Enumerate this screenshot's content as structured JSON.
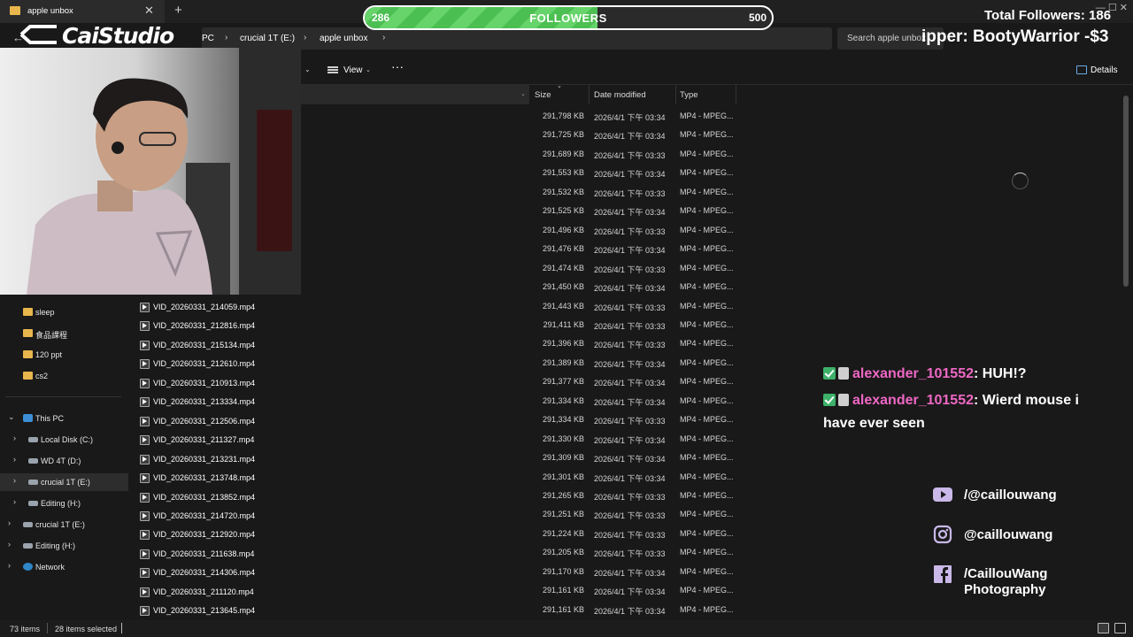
{
  "window": {
    "tab_title": "apple unbox",
    "tab_close": "✕",
    "tab_add": "+",
    "window_controls": "— ☐ ✕"
  },
  "address": {
    "back_icon": "←",
    "crumbs": [
      "PC",
      "crucial 1T (E:)",
      "apple unbox"
    ],
    "separator": "›",
    "search_placeholder": "Search apple unbox"
  },
  "commandbar": {
    "view_label": "View",
    "view_caret": "⌄",
    "more_label": "···",
    "details_label": "Details",
    "chevron": "⌄"
  },
  "columns": {
    "size": "Size",
    "date_modified": "Date modified",
    "type": "Type"
  },
  "sidebar": {
    "items": [
      {
        "label": "sleep",
        "icon": "folder-icon"
      },
      {
        "label": "食品課程",
        "icon": "folder-icon"
      },
      {
        "label": "120 ppt",
        "icon": "folder-icon"
      },
      {
        "label": "cs2",
        "icon": "folder-icon"
      },
      {
        "label": "This PC",
        "icon": "pc-icon",
        "expanded": true
      },
      {
        "label": "Local Disk (C:)",
        "icon": "disk-icon"
      },
      {
        "label": "WD 4T (D:)",
        "icon": "disk-icon"
      },
      {
        "label": "crucial 1T (E:)",
        "icon": "disk-icon",
        "selected": true
      },
      {
        "label": "Editing (H:)",
        "icon": "disk-icon"
      },
      {
        "label": "crucial 1T (E:)",
        "icon": "disk-icon"
      },
      {
        "label": "Editing (H:)",
        "icon": "disk-icon"
      },
      {
        "label": "Network",
        "icon": "network-icon"
      }
    ],
    "expand_icon": "›",
    "collapse_icon": "⌄"
  },
  "files": {
    "names": [
      "VID_20260331_214059.mp4",
      "VID_20260331_212816.mp4",
      "VID_20260331_215134.mp4",
      "VID_20260331_212610.mp4",
      "VID_20260331_210913.mp4",
      "VID_20260331_213334.mp4",
      "VID_20260331_212506.mp4",
      "VID_20260331_211327.mp4",
      "VID_20260331_213231.mp4",
      "VID_20260331_213748.mp4",
      "VID_20260331_213852.mp4",
      "VID_20260331_214720.mp4",
      "VID_20260331_212920.mp4",
      "VID_20260331_211638.mp4",
      "VID_20260331_214306.mp4",
      "VID_20260331_211120.mp4",
      "VID_20260331_213645.mp4"
    ],
    "rows": [
      {
        "size": "291,798 KB",
        "date": "2026/4/1 下午 03:34",
        "type": "MP4 - MPEG..."
      },
      {
        "size": "291,725 KB",
        "date": "2026/4/1 下午 03:34",
        "type": "MP4 - MPEG..."
      },
      {
        "size": "291,689 KB",
        "date": "2026/4/1 下午 03:33",
        "type": "MP4 - MPEG..."
      },
      {
        "size": "291,553 KB",
        "date": "2026/4/1 下午 03:34",
        "type": "MP4 - MPEG..."
      },
      {
        "size": "291,532 KB",
        "date": "2026/4/1 下午 03:33",
        "type": "MP4 - MPEG..."
      },
      {
        "size": "291,525 KB",
        "date": "2026/4/1 下午 03:34",
        "type": "MP4 - MPEG..."
      },
      {
        "size": "291,496 KB",
        "date": "2026/4/1 下午 03:33",
        "type": "MP4 - MPEG..."
      },
      {
        "size": "291,476 KB",
        "date": "2026/4/1 下午 03:34",
        "type": "MP4 - MPEG..."
      },
      {
        "size": "291,474 KB",
        "date": "2026/4/1 下午 03:33",
        "type": "MP4 - MPEG..."
      },
      {
        "size": "291,450 KB",
        "date": "2026/4/1 下午 03:34",
        "type": "MP4 - MPEG..."
      },
      {
        "size": "291,443 KB",
        "date": "2026/4/1 下午 03:33",
        "type": "MP4 - MPEG..."
      },
      {
        "size": "291,411 KB",
        "date": "2026/4/1 下午 03:33",
        "type": "MP4 - MPEG..."
      },
      {
        "size": "291,396 KB",
        "date": "2026/4/1 下午 03:33",
        "type": "MP4 - MPEG..."
      },
      {
        "size": "291,389 KB",
        "date": "2026/4/1 下午 03:34",
        "type": "MP4 - MPEG..."
      },
      {
        "size": "291,377 KB",
        "date": "2026/4/1 下午 03:34",
        "type": "MP4 - MPEG..."
      },
      {
        "size": "291,334 KB",
        "date": "2026/4/1 下午 03:34",
        "type": "MP4 - MPEG..."
      },
      {
        "size": "291,334 KB",
        "date": "2026/4/1 下午 03:33",
        "type": "MP4 - MPEG..."
      },
      {
        "size": "291,330 KB",
        "date": "2026/4/1 下午 03:34",
        "type": "MP4 - MPEG..."
      },
      {
        "size": "291,309 KB",
        "date": "2026/4/1 下午 03:34",
        "type": "MP4 - MPEG..."
      },
      {
        "size": "291,301 KB",
        "date": "2026/4/1 下午 03:34",
        "type": "MP4 - MPEG..."
      },
      {
        "size": "291,265 KB",
        "date": "2026/4/1 下午 03:33",
        "type": "MP4 - MPEG..."
      },
      {
        "size": "291,251 KB",
        "date": "2026/4/1 下午 03:33",
        "type": "MP4 - MPEG..."
      },
      {
        "size": "291,224 KB",
        "date": "2026/4/1 下午 03:33",
        "type": "MP4 - MPEG..."
      },
      {
        "size": "291,205 KB",
        "date": "2026/4/1 下午 03:33",
        "type": "MP4 - MPEG..."
      },
      {
        "size": "291,170 KB",
        "date": "2026/4/1 下午 03:34",
        "type": "MP4 - MPEG..."
      },
      {
        "size": "291,161 KB",
        "date": "2026/4/1 下午 03:34",
        "type": "MP4 - MPEG..."
      },
      {
        "size": "291,161 KB",
        "date": "2026/4/1 下午 03:34",
        "type": "MP4 - MPEG..."
      }
    ]
  },
  "status": {
    "item_count": "73 items",
    "selected_count": "28 items selected"
  },
  "overlay": {
    "followers": {
      "current": "286",
      "label": "FOLLOWERS",
      "goal": "500",
      "progress_fraction": 0.572
    },
    "total_followers": "Total Followers: 186",
    "ticker": "ipper: BootyWarrior -$3",
    "logo": "CaiStudio",
    "chat": [
      {
        "user": "alexander_101552",
        "message": ": HUH!?"
      },
      {
        "user": "alexander_101552",
        "message": ": Wierd mouse i have ever seen"
      }
    ],
    "socials": [
      {
        "icon": "youtube-icon",
        "text": "/@caillouwang"
      },
      {
        "icon": "instagram-icon",
        "text": "@caillouwang"
      },
      {
        "icon": "facebook-icon",
        "text": "/CaillouWang Photography"
      }
    ]
  },
  "colors": {
    "accent_blue": "#6aa9e6",
    "folder_yellow": "#e8b64c",
    "chat_username": "#ee67c4",
    "progress_green": "#66d46a"
  }
}
